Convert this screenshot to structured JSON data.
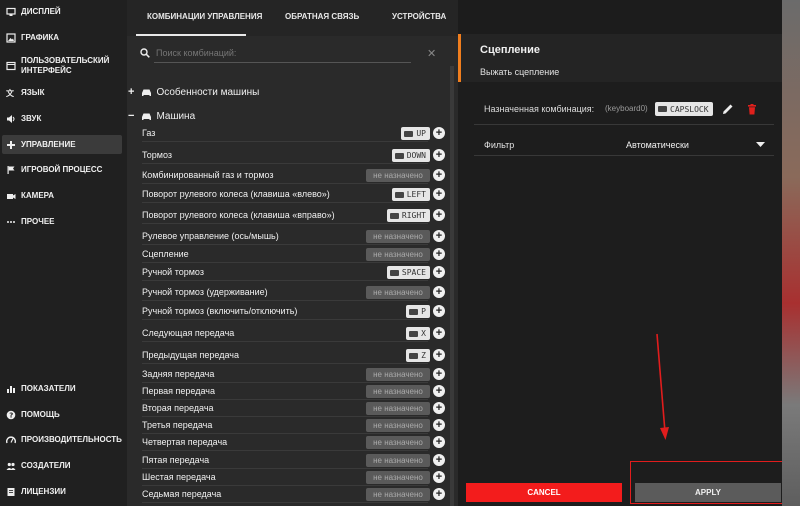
{
  "sidebar": {
    "top_items": [
      {
        "label": "ДИСПЛЕЙ",
        "icon": "display-icon"
      },
      {
        "label": "ГРАФИКА",
        "icon": "image-icon"
      },
      {
        "label": "ПОЛЬЗОВАТЕЛЬСКИЙ ИНТЕРФЕЙС",
        "icon": "interface-icon"
      },
      {
        "label": "ЯЗЫК",
        "icon": "translate-icon"
      },
      {
        "label": "ЗВУК",
        "icon": "speaker-icon"
      },
      {
        "label": "УПРАВЛЕНИЕ",
        "icon": "gamepad-icon",
        "active": true
      },
      {
        "label": "ИГРОВОЙ ПРОЦЕСС",
        "icon": "flag-icon"
      },
      {
        "label": "КАМЕРА",
        "icon": "camera-icon"
      },
      {
        "label": "ПРОЧЕЕ",
        "icon": "more-icon"
      }
    ],
    "bottom_items": [
      {
        "label": "ПОКАЗАТЕЛИ",
        "icon": "chart-icon"
      },
      {
        "label": "ПОМОЩЬ",
        "icon": "help-icon"
      },
      {
        "label": "ПРОИЗВОДИТЕЛЬНОСТЬ",
        "icon": "performance-icon"
      },
      {
        "label": "СОЗДАТЕЛИ",
        "icon": "people-icon"
      },
      {
        "label": "ЛИЦЕНЗИИ",
        "icon": "license-icon"
      }
    ]
  },
  "tabs": [
    {
      "label": "КОМБИНАЦИИ УПРАВЛЕНИЯ",
      "active": true
    },
    {
      "label": "ОБРАТНАЯ СВЯЗЬ"
    },
    {
      "label": "УСТРОЙСТВА"
    }
  ],
  "search": {
    "placeholder": "Поиск комбинаций:"
  },
  "sections": {
    "vehicle_features": "Особенности машины",
    "vehicle": "Машина"
  },
  "bindings": [
    {
      "label": "Газ",
      "key": "UP"
    },
    {
      "label": "Тормоз",
      "key": "DOWN"
    },
    {
      "label": "Комбинированный газ и тормоз",
      "key": null
    },
    {
      "label": "Поворот рулевого колеса (клавиша «влево»)",
      "key": "LEFT"
    },
    {
      "label": "Поворот рулевого колеса (клавиша «вправо»)",
      "key": "RIGHT"
    },
    {
      "label": "Рулевое управление (ось/мышь)",
      "key": null
    },
    {
      "label": "Сцепление",
      "key": null
    },
    {
      "label": "Ручной тормоз",
      "key": "SPACE"
    },
    {
      "label": "Ручной тормоз (удерживание)",
      "key": null
    },
    {
      "label": "Ручной тормоз (включить/отключить)",
      "key": "P"
    },
    {
      "label": "Следующая передача",
      "key": "X"
    },
    {
      "label": "Предыдущая передача",
      "key": "Z"
    },
    {
      "label": "Задняя передача",
      "key": null
    },
    {
      "label": "Первая передача",
      "key": null
    },
    {
      "label": "Вторая передача",
      "key": null
    },
    {
      "label": "Третья передача",
      "key": null
    },
    {
      "label": "Четвертая передача",
      "key": null
    },
    {
      "label": "Пятая передача",
      "key": null
    },
    {
      "label": "Шестая передача",
      "key": null
    },
    {
      "label": "Седьмая передача",
      "key": null
    }
  ],
  "unassigned_label": "не назначено",
  "detail": {
    "title": "Сцепление",
    "subtitle": "Выжать сцепление",
    "assigned_label": "Назначенная комбинация:",
    "device": "(keyboard0)",
    "key": "CAPSLOCK",
    "filter_label": "Фильтр",
    "filter_value": "Автоматически"
  },
  "buttons": {
    "cancel": "CANCEL",
    "apply": "APPLY"
  },
  "colors": {
    "accent_orange": "#f07e1e",
    "cancel_red": "#f31c1c",
    "delete_red": "#e0201c",
    "annotation_red": "#e11d1d"
  }
}
